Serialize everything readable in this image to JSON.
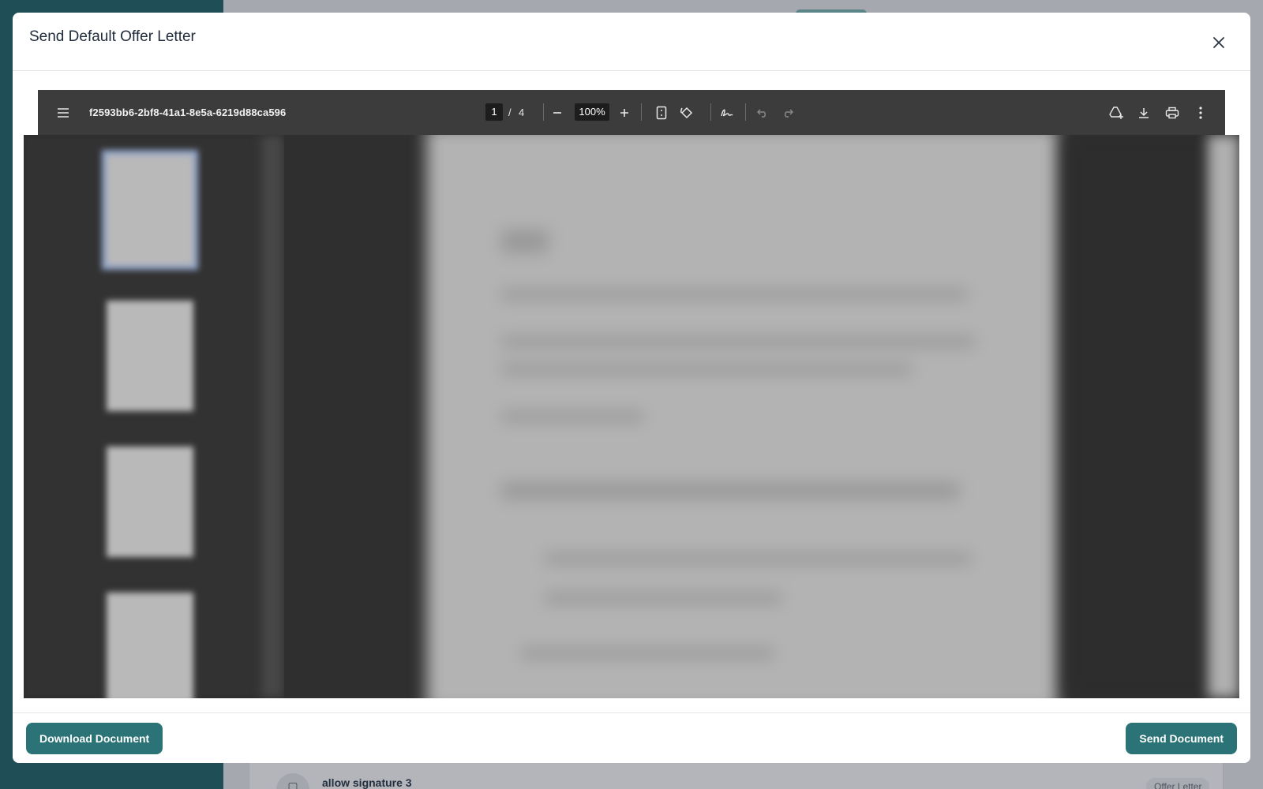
{
  "modal": {
    "title": "Send Default Offer Letter",
    "close_icon": "close-icon"
  },
  "pdf_viewer": {
    "file_name": "f2593bb6-2bf8-41a1-8e5a-6219d88ca596",
    "current_page": "1",
    "page_separator": "/",
    "total_pages": "4",
    "zoom": "100%",
    "icons": {
      "menu": "hamburger-menu-icon",
      "zoom_out": "minus-icon",
      "zoom_in": "plus-icon",
      "fit_page": "fit-page-icon",
      "rotate": "rotate-icon",
      "annotate": "draw-signature-icon",
      "undo": "undo-icon",
      "redo": "redo-icon",
      "add_to_drive": "add-to-drive-icon",
      "download": "download-icon",
      "print": "print-icon",
      "more": "more-vertical-icon"
    },
    "thumbnail_count": 4
  },
  "footer": {
    "download_label": "Download Document",
    "send_label": "Send Document"
  },
  "background": {
    "card_title": "allow signature 3",
    "card_badge": "Offer Letter"
  },
  "colors": {
    "accent": "#2b7377",
    "sidebar": "#1f4e56",
    "toolbar": "#3c3c3c"
  }
}
